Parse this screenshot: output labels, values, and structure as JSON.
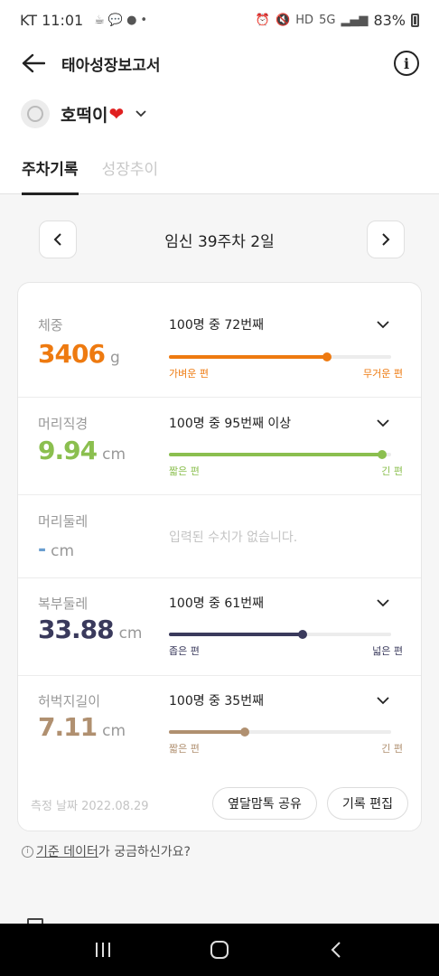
{
  "status_bar": {
    "carrier_time": "KT 11:01",
    "battery": "83%",
    "network": "5G"
  },
  "header": {
    "title": "태아성장보고서"
  },
  "baby": {
    "name": "호떡이",
    "heart": "❤"
  },
  "tabs": [
    {
      "label": "주차기록",
      "active": true
    },
    {
      "label": "성장추이",
      "active": false
    }
  ],
  "week_nav": {
    "label": "임신 39주차 2일"
  },
  "metrics": [
    {
      "label": "체중",
      "value": "3406",
      "unit": "g",
      "rank": "100명 중 72번째",
      "left_label": "가벼운 편",
      "right_label": "무거운 편",
      "position": 0.71,
      "color": "#ee7a10"
    },
    {
      "label": "머리직경",
      "value": "9.94",
      "unit": "cm",
      "rank": "100명 중 95번째 이상",
      "left_label": "짧은 편",
      "right_label": "긴 편",
      "position": 0.96,
      "color": "#8bbf4f"
    },
    {
      "label": "머리둘레",
      "value": "-",
      "unit": "cm",
      "empty_text": "입력된 수치가 없습니다.",
      "color": "#6a9ed0"
    },
    {
      "label": "복부둘레",
      "value": "33.88",
      "unit": "cm",
      "rank": "100명 중 61번째",
      "left_label": "좁은 편",
      "right_label": "넓은 편",
      "position": 0.6,
      "color": "#3a3a5c"
    },
    {
      "label": "허벅지길이",
      "value": "7.11",
      "unit": "cm",
      "rank": "100명 중 35번째",
      "left_label": "짧은 편",
      "right_label": "긴 편",
      "position": 0.34,
      "color": "#b09070"
    }
  ],
  "footer": {
    "measure_date": "측정 날짜 2022.08.29",
    "share_label": "옆달맘톡 공유",
    "edit_label": "기록 편집"
  },
  "help": {
    "link_text": "기준 데이터",
    "rest_text": "가 궁금하신가요?"
  }
}
